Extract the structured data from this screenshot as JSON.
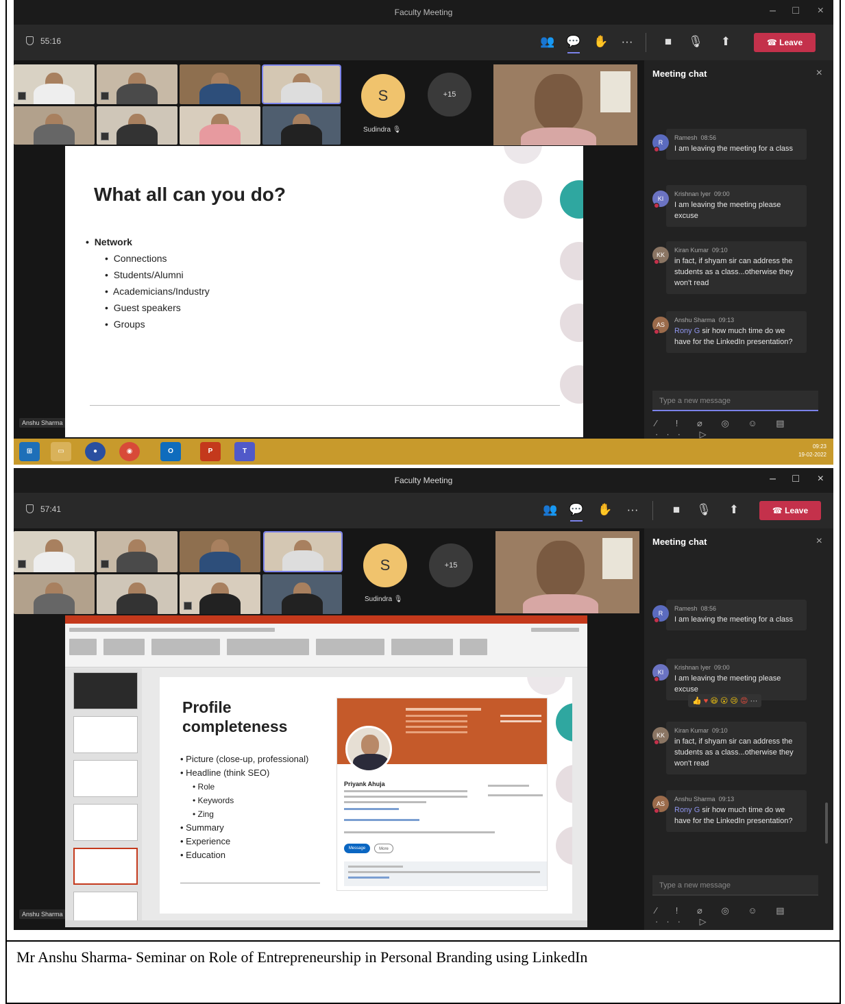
{
  "screenshot1": {
    "window_title": "Faculty Meeting",
    "timer": "55:16",
    "leave_label": "Leave",
    "participant_name": "Sudindra",
    "avatar_letter": "S",
    "overflow_count": "+15",
    "presenter_name": "Anshu Sharma",
    "chat": {
      "title": "Meeting chat",
      "messages": [
        {
          "initials": "R",
          "sender": "Ramesh",
          "time": "08:56",
          "text": "I am leaving the meeting for a class"
        },
        {
          "initials": "KI",
          "sender": "Krishnan Iyer",
          "time": "09:00",
          "text": "I am leaving the meeting please excuse"
        },
        {
          "initials": "KK",
          "sender": "Kiran Kumar",
          "time": "09:10",
          "text": "in fact, if shyam sir can address the students as a class...otherwise they won't read"
        },
        {
          "initials": "AS",
          "sender": "Anshu Sharma",
          "time": "09:13",
          "mention": "Rony G",
          "text": " sir how much time do we have for the LinkedIn presentation?"
        }
      ],
      "compose_placeholder": "Type a new message"
    },
    "slide": {
      "title": "What all can you do?",
      "bullet_main": "Network",
      "bullets": [
        "Connections",
        "Students/Alumni",
        "Academicians/Industry",
        "Guest speakers",
        "Groups"
      ]
    },
    "taskbar": {
      "apps": [
        "start",
        "explorer",
        "chrome",
        "outlook",
        "powerpoint",
        "teams"
      ],
      "clock_time": "09:23",
      "clock_date": "19-02-2022"
    }
  },
  "screenshot2": {
    "window_title": "Faculty Meeting",
    "timer": "57:41",
    "leave_label": "Leave",
    "participant_name": "Sudindra",
    "avatar_letter": "S",
    "overflow_count": "+15",
    "presenter_name": "Anshu Sharma",
    "chat": {
      "title": "Meeting chat",
      "messages": [
        {
          "initials": "R",
          "sender": "Ramesh",
          "time": "08:56",
          "text": "I am leaving the meeting for a class"
        },
        {
          "initials": "KI",
          "sender": "Krishnan Iyer",
          "time": "09:00",
          "text": "I am leaving the meeting please excuse"
        },
        {
          "initials": "KK",
          "sender": "Kiran Kumar",
          "time": "09:10",
          "text": "in fact, if shyam sir can address the students as a class...otherwise they won't read"
        },
        {
          "initials": "AS",
          "sender": "Anshu Sharma",
          "time": "09:13",
          "mention": "Rony G",
          "text": " sir how much time do we have for the LinkedIn presentation?"
        }
      ],
      "compose_placeholder": "Type a new message"
    },
    "slide": {
      "title": "Profile completeness",
      "items": [
        "Picture (close-up, professional)",
        "Headline (think SEO)"
      ],
      "subitems": [
        "Role",
        "Keywords",
        "Zing"
      ],
      "items_after": [
        "Summary",
        "Experience",
        "Education"
      ]
    },
    "linkedin_card": {
      "name": "Priyank Ahuja",
      "button_message": "Message",
      "button_more": "More"
    }
  },
  "caption": "Mr Anshu Sharma- Seminar on Role of Entrepreneurship in Personal Branding using LinkedIn",
  "colors": {
    "teams_accent": "#7b83eb",
    "leave_red": "#c4314b",
    "slide_teal": "#2fa7a0",
    "ppt_orange": "#c4391c"
  }
}
